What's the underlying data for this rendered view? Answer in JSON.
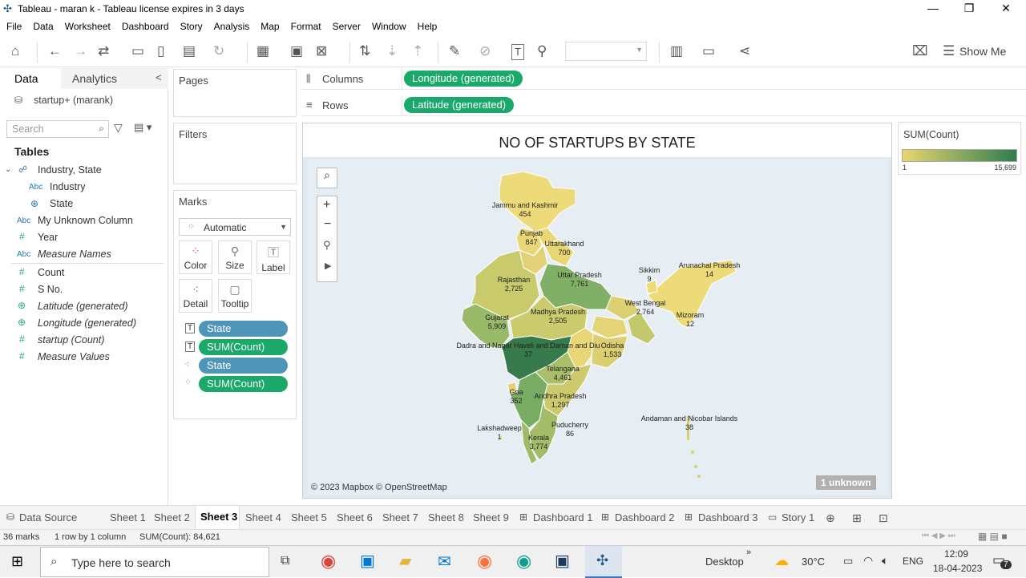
{
  "window": {
    "title": "Tableau - maran k - Tableau license expires in 3 days",
    "minimize": "—",
    "maximize": "❐",
    "close": "✕"
  },
  "menu": [
    "File",
    "Data",
    "Worksheet",
    "Dashboard",
    "Story",
    "Analysis",
    "Map",
    "Format",
    "Server",
    "Window",
    "Help"
  ],
  "toolbar": {
    "show_me": "Show Me"
  },
  "data_pane": {
    "tab_data": "Data",
    "tab_analytics": "Analytics",
    "collapse": "<",
    "datasource": "startup+ (marank)",
    "search_placeholder": "Search",
    "tables_header": "Tables",
    "folder": "Industry, State",
    "fields": [
      {
        "name": "Industry",
        "type": "Abc"
      },
      {
        "name": "State",
        "type": "geo"
      },
      {
        "name": "My Unknown Column",
        "type": "Abc"
      },
      {
        "name": "Year",
        "type": "#"
      },
      {
        "name": "Measure Names",
        "type": "Abc"
      },
      {
        "name": "Count",
        "type": "#"
      },
      {
        "name": "S No.",
        "type": "#"
      },
      {
        "name": "Latitude (generated)",
        "type": "geo"
      },
      {
        "name": "Longitude (generated)",
        "type": "geo"
      },
      {
        "name": "startup (Count)",
        "type": "#"
      },
      {
        "name": "Measure Values",
        "type": "#"
      }
    ]
  },
  "shelves": {
    "pages": "Pages",
    "filters": "Filters",
    "marks": "Marks",
    "mark_type": "Automatic",
    "columns_label": "Columns",
    "rows_label": "Rows",
    "columns_pill": "Longitude (generated)",
    "rows_pill": "Latitude (generated)",
    "mark_buttons": [
      "Color",
      "Size",
      "Label",
      "Detail",
      "Tooltip"
    ],
    "mark_pills": [
      "State",
      "SUM(Count)",
      "State",
      "SUM(Count)"
    ]
  },
  "viz": {
    "title": "NO OF STARTUPS BY STATE",
    "attribution": "© 2023 Mapbox © OpenStreetMap",
    "unknown": "1 unknown",
    "map_states": [
      {
        "name": "Jammu and Kashmir",
        "value": "454"
      },
      {
        "name": "Punjab",
        "value": "847"
      },
      {
        "name": "Uttarakhand",
        "value": "700"
      },
      {
        "name": "Rajasthan",
        "value": "2,725"
      },
      {
        "name": "Uttar Pradesh",
        "value": "7,761"
      },
      {
        "name": "Sikkim",
        "value": "9"
      },
      {
        "name": "Arunachal Pradesh",
        "value": "14"
      },
      {
        "name": "Gujarat",
        "value": "5,909"
      },
      {
        "name": "Madhya Pradesh",
        "value": "2,505"
      },
      {
        "name": "West Bengal",
        "value": "2,764"
      },
      {
        "name": "Mizoram",
        "value": "12"
      },
      {
        "name": "Dadra and Nagar Haveli and Daman and Diu",
        "value": "37"
      },
      {
        "name": "Odisha",
        "value": "1,533"
      },
      {
        "name": "Telangana",
        "value": "4,461"
      },
      {
        "name": "Goa",
        "value": "352"
      },
      {
        "name": "Andhra Pradesh",
        "value": "1,297"
      },
      {
        "name": "Puducherry",
        "value": "86"
      },
      {
        "name": "Lakshadweep",
        "value": "1"
      },
      {
        "name": "Kerala",
        "value": "3,774"
      },
      {
        "name": "Andaman and Nicobar Islands",
        "value": "38"
      }
    ]
  },
  "legend": {
    "title": "SUM(Count)",
    "min": "1",
    "max": "15,699",
    "color_low": "#e8d66f",
    "color_high": "#2f7d4f"
  },
  "sheet_tabs": [
    "Data Source",
    "Sheet 1",
    "Sheet 2",
    "Sheet 3",
    "Sheet 4",
    "Sheet 5",
    "Sheet 6",
    "Sheet 7",
    "Sheet 8",
    "Sheet 9",
    "Dashboard 1",
    "Dashboard 2",
    "Dashboard 3",
    "Story 1"
  ],
  "active_tab": "Sheet 3",
  "status": {
    "marks": "36 marks",
    "rows": "1 row by 1 column",
    "sum": "SUM(Count): 84,621"
  },
  "taskbar": {
    "search_placeholder": "Type here to search",
    "desktop": "Desktop",
    "temp": "30°C",
    "lang": "ENG",
    "time": "12:09",
    "date": "18-04-2023",
    "notif": "7"
  }
}
